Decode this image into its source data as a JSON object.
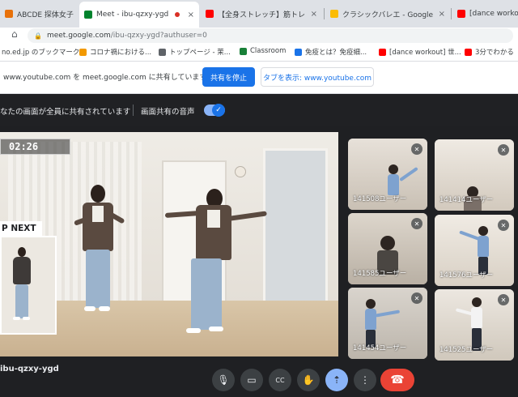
{
  "browser": {
    "tabs": [
      {
        "title": "ABCDE 探体女子",
        "favicon_color": "#e8710a",
        "icon": "generic-favicon-icon"
      },
      {
        "title": "Meet - ibu-qzxy-ygd",
        "favicon_color": "#00832d",
        "icon": "meet-icon",
        "active": true
      },
      {
        "title": "【全身ストレッチ】筋トレ",
        "favicon_color": "#ff0000",
        "icon": "youtube-icon"
      },
      {
        "title": "クラシックバレエ - Google",
        "favicon_color": "#fbbc04",
        "icon": "docs-icon"
      },
      {
        "title": "[dance workout] ...",
        "favicon_color": "#ff0000",
        "icon": "youtube-icon"
      }
    ],
    "url_domain": "meet.google.com",
    "url_path": "/ibu-qzxy-ygd?authuser=0",
    "bookmarks": [
      {
        "label": "no.ed.jp のブックマーク",
        "color": "#9aa0a6"
      },
      {
        "label": "コロナ禍における...",
        "color": "#f29900"
      },
      {
        "label": "トップページ - 茉...",
        "color": "#5f6368"
      },
      {
        "label": "Classroom",
        "color": "#188038"
      },
      {
        "label": "免疫とは？免疫細...",
        "color": "#1a73e8"
      },
      {
        "label": "[dance workout] 世...",
        "color": "#ff0000"
      },
      {
        "label": "3分でわかる",
        "color": "#ff0000"
      }
    ]
  },
  "infobar": {
    "message": "www.youtube.com を meet.google.com に共有しています",
    "stop_label": "共有を停止",
    "show_tab_label": "タブを表示: www.youtube.com"
  },
  "presentbar": {
    "message": "なたの画面が全員に共有されています",
    "audio_label": "画面共有の音声",
    "audio_on": true
  },
  "video": {
    "timer": "02:26",
    "up_next": "P NEXT"
  },
  "participants": [
    {
      "name": "141508ユーザー",
      "bg": "#d7d0c6"
    },
    {
      "name": "141414ユーザー",
      "bg": "#d9d2c8"
    },
    {
      "name": "141585ユーザー",
      "bg": "#ccc6bd"
    },
    {
      "name": "141576ユーザー",
      "bg": "#e3ddd5"
    },
    {
      "name": "141454ユーザー",
      "bg": "#cfcac2"
    },
    {
      "name": "141525ユーザー",
      "bg": "#dcd7d0"
    }
  ],
  "meeting_code": "ibu-qzxy-ygd",
  "controls": [
    {
      "name": "mic-button",
      "glyph": "🎙"
    },
    {
      "name": "camera-button",
      "glyph": "▭"
    },
    {
      "name": "captions-button",
      "glyph": "CC"
    },
    {
      "name": "raise-hand-button",
      "glyph": "✋"
    },
    {
      "name": "present-button",
      "glyph": "⇡"
    },
    {
      "name": "more-options-button",
      "glyph": "⋮"
    }
  ],
  "hangup_glyph": "☎"
}
